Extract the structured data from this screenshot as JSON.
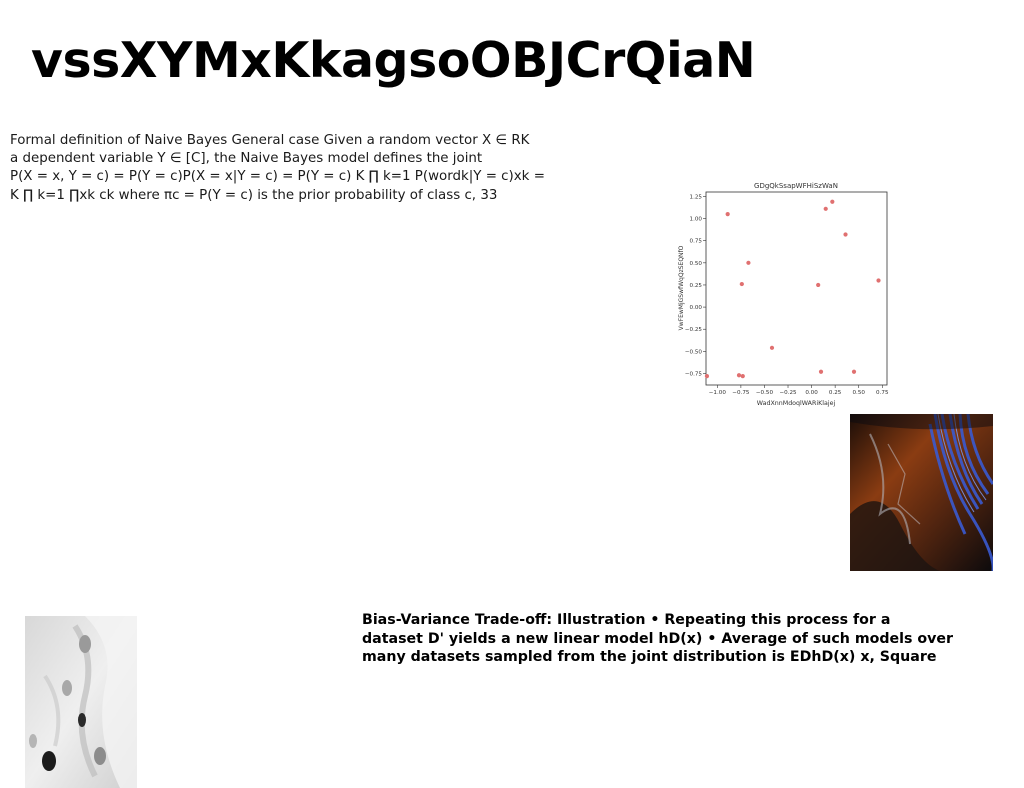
{
  "title": "vssXYMxKkagsoOBJCrQiaN",
  "naive_bayes_lines": [
    "Formal definition of Naive Bayes General case Given a random vector X ∈ RK",
    "a dependent variable Y ∈ [C], the Naive Bayes model defines the joint",
    "P(X = x, Y = c) = P(Y = c)P(X = x|Y = c) = P(Y = c) K ∏ k=1 P(wordk|Y = c)xk =",
    "K ∏ k=1 ∏xk ck where πc = P(Y = c) is the prior probability of class c, 33"
  ],
  "bias_variance_lines": [
    "Bias-Variance Trade-off: Illustration • Repeating this process for a",
    "dataset D' yields a new linear model hD(x) • Average of such models over",
    "many datasets sampled from the joint distribution is EDhD(x) x, Square"
  ],
  "chart_data": {
    "type": "scatter",
    "title": "GDgQkSsapWFHiSzWaN",
    "xlabel": "WadXnnMdoqlWARiKlajej",
    "ylabel": "VwFEwMjGSwfWqQzSEQNfO",
    "xlim": [
      -1.12,
      0.8
    ],
    "ylim": [
      -0.88,
      1.3
    ],
    "x_ticks": [
      -1.0,
      -0.75,
      -0.5,
      -0.25,
      0.0,
      0.25,
      0.5,
      0.75
    ],
    "x_tick_labels": [
      "−1.00",
      "−0.75",
      "−0.50",
      "−0.25",
      "0.00",
      "0.25",
      "0.50",
      "0.75"
    ],
    "y_ticks": [
      1.25,
      1.0,
      0.75,
      0.5,
      0.25,
      0.0,
      -0.25,
      -0.5,
      -0.75
    ],
    "y_tick_labels": [
      "1.25",
      "1.00",
      "0.75",
      "0.50",
      "0.25",
      "0.00",
      "−0.25",
      "−0.50",
      "−0.75"
    ],
    "grid": false,
    "marker_color": "#e07070",
    "points": [
      {
        "x": -1.11,
        "y": -0.78
      },
      {
        "x": -0.89,
        "y": 1.05
      },
      {
        "x": -0.77,
        "y": -0.77
      },
      {
        "x": -0.74,
        "y": 0.26
      },
      {
        "x": -0.73,
        "y": -0.78
      },
      {
        "x": -0.67,
        "y": 0.5
      },
      {
        "x": -0.42,
        "y": -0.46
      },
      {
        "x": 0.07,
        "y": 0.25
      },
      {
        "x": 0.1,
        "y": -0.73
      },
      {
        "x": 0.15,
        "y": 1.11
      },
      {
        "x": 0.22,
        "y": 1.19
      },
      {
        "x": 0.36,
        "y": 0.82
      },
      {
        "x": 0.45,
        "y": -0.73
      },
      {
        "x": 0.71,
        "y": 0.3
      }
    ]
  }
}
